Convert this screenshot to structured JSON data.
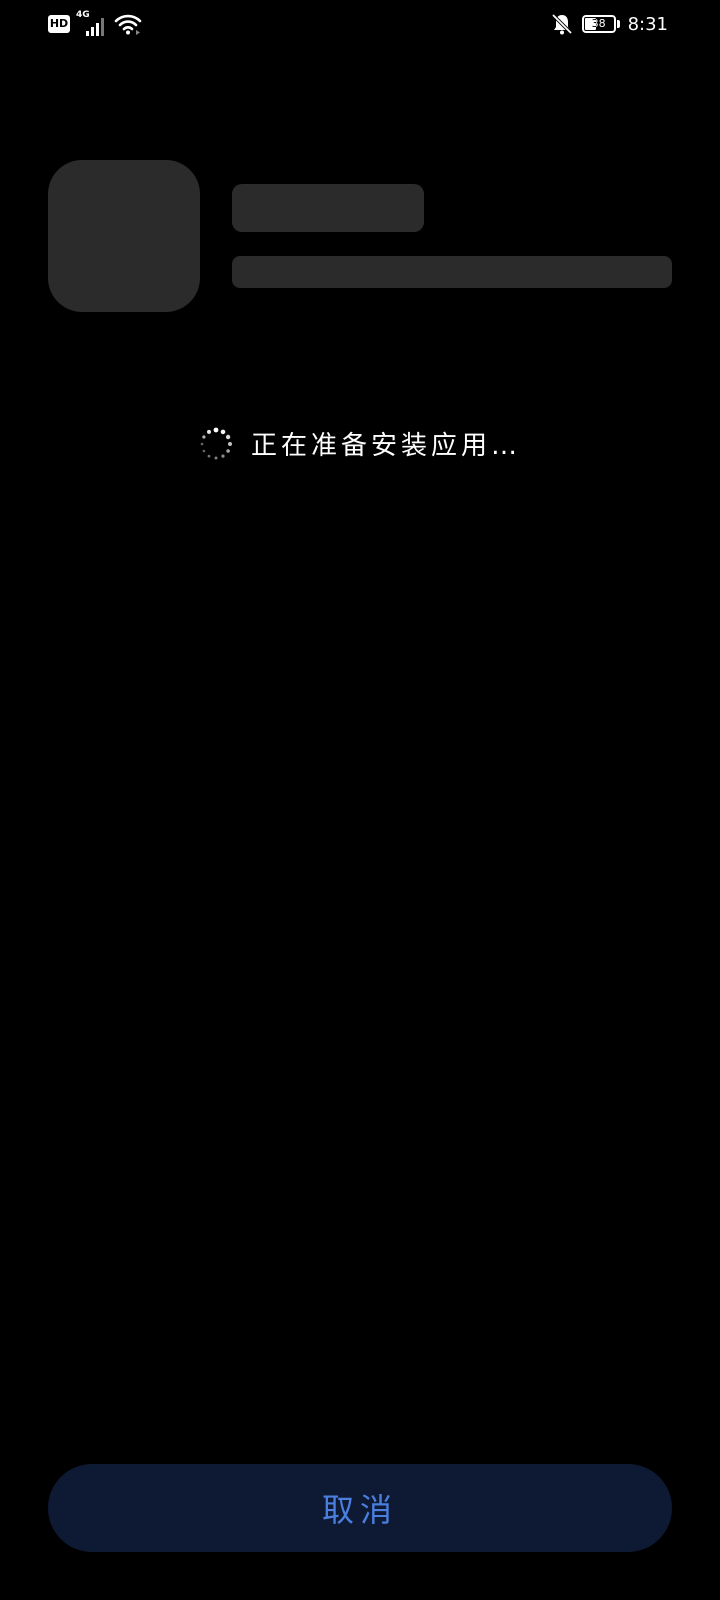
{
  "status_bar": {
    "hd_label": "HD",
    "network_type": "4G",
    "battery_level": "38",
    "battery_fraction": 0.38,
    "time": "8:31",
    "icons": [
      "hd-icon",
      "signal-icon",
      "wifi-icon",
      "bell-muted-icon",
      "battery-icon"
    ]
  },
  "installer": {
    "status_text": "正在准备安装应用…"
  },
  "actions": {
    "cancel_label": "取消"
  },
  "colors": {
    "background": "#000000",
    "placeholder": "#2b2b2b",
    "button_background": "#0e1a33",
    "accent": "#4a7fe0",
    "text": "#ffffff"
  }
}
